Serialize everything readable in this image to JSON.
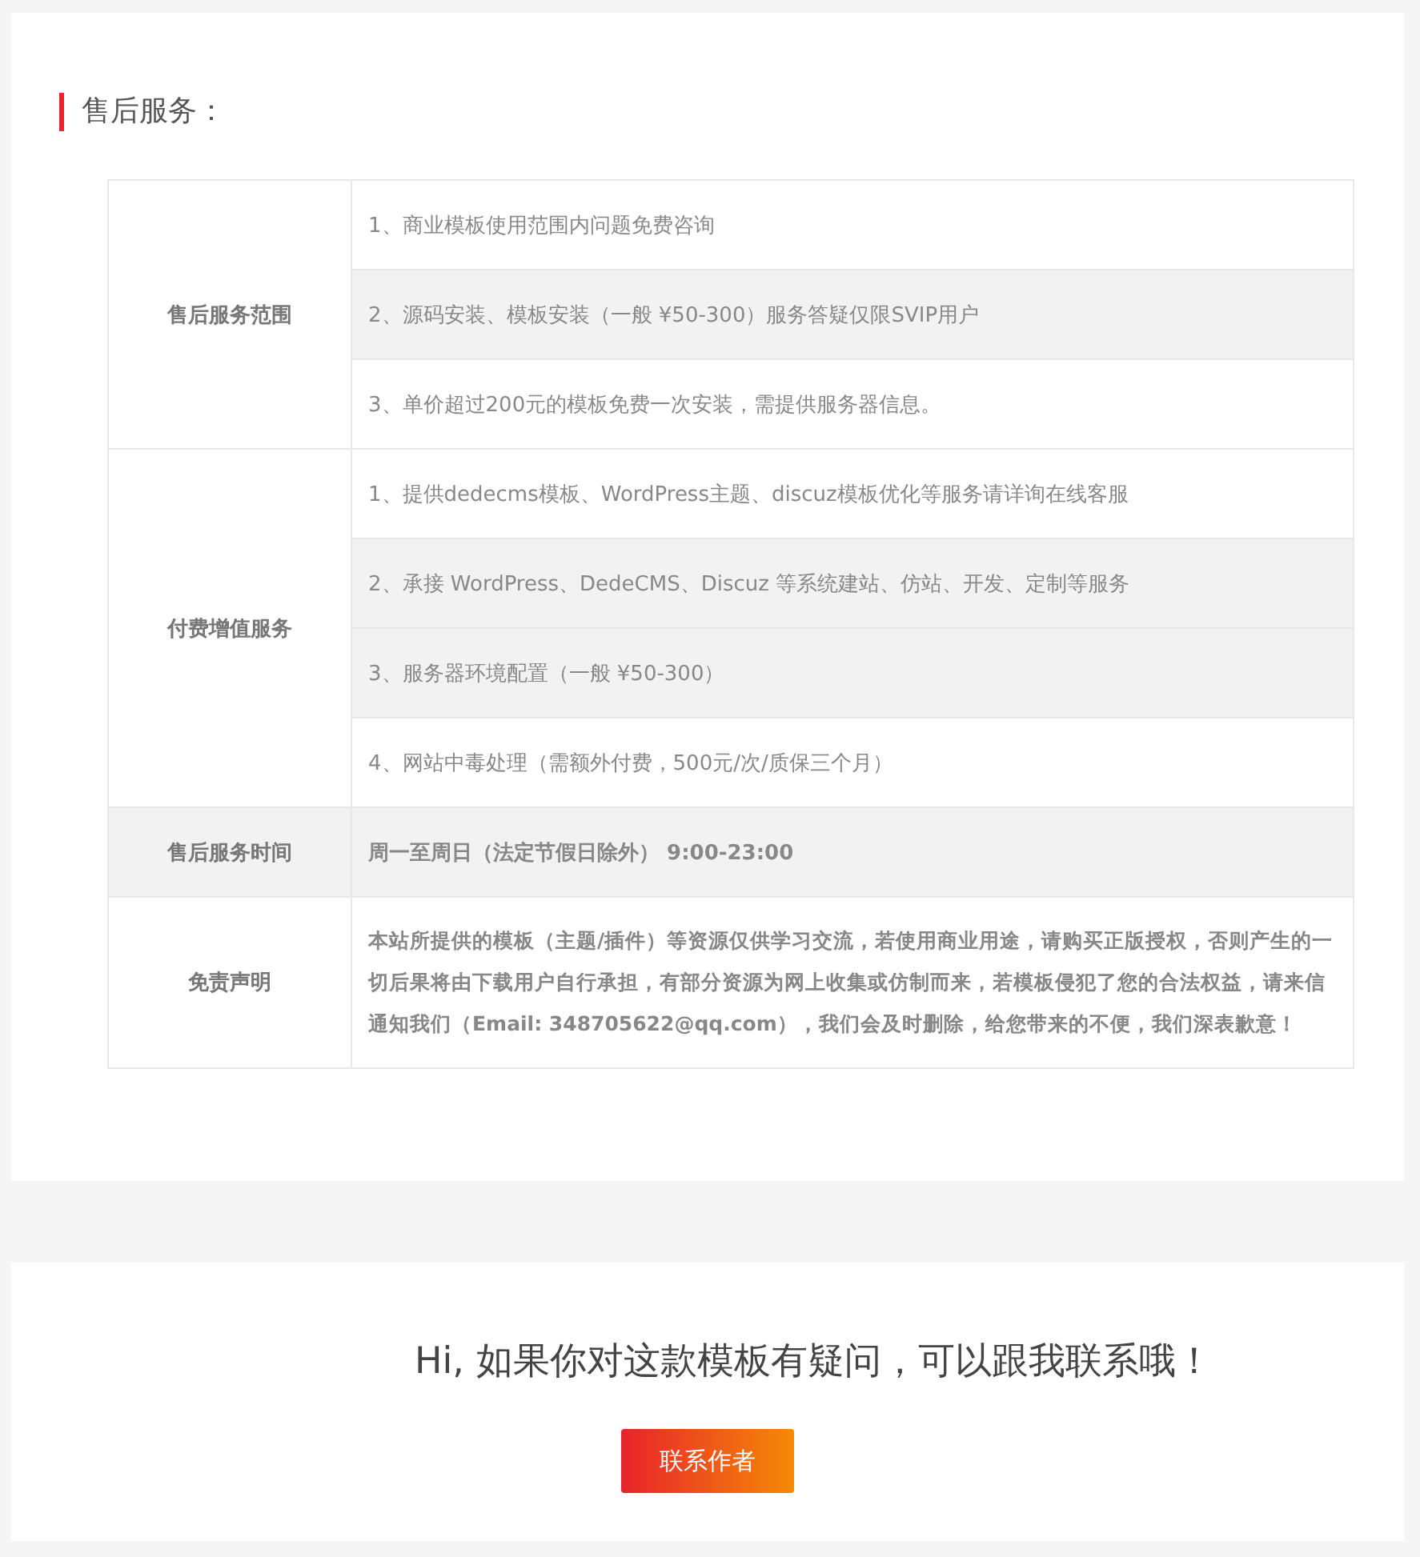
{
  "section_title": "售后服务：",
  "groups": [
    {
      "label": "售后服务范围",
      "shaded": false,
      "bold": false,
      "items": [
        {
          "text": "1、商业模板使用范围内问题免费咨询",
          "shaded": false
        },
        {
          "text": "2、源码安装、模板安装（一般 ¥50-300）服务答疑仅限SVIP用户",
          "shaded": true
        },
        {
          "text": "3、单价超过200元的模板免费一次安装，需提供服务器信息。",
          "shaded": false
        }
      ]
    },
    {
      "label": "付费增值服务",
      "shaded": false,
      "bold": false,
      "items": [
        {
          "text": "1、提供dedecms模板、WordPress主题、discuz模板优化等服务请详询在线客服",
          "shaded": false
        },
        {
          "text": "2、承接 WordPress、DedeCMS、Discuz 等系统建站、仿站、开发、定制等服务",
          "shaded": true
        },
        {
          "text": "3、服务器环境配置（一般 ¥50-300）",
          "shaded": true
        },
        {
          "text": "4、网站中毒处理（需额外付费，500元/次/质保三个月）",
          "shaded": false
        }
      ]
    },
    {
      "label": "售后服务时间",
      "shaded": true,
      "bold": true,
      "items": [
        {
          "text": "周一至周日（法定节假日除外） 9:00-23:00",
          "shaded": true
        }
      ]
    },
    {
      "label": "免责声明",
      "shaded": false,
      "bold": true,
      "items": [
        {
          "text": "本站所提供的模板（主题/插件）等资源仅供学习交流，若使用商业用途，请购买正版授权，否则产生的一切后果将由下载用户自行承担，有部分资源为网上收集或仿制而来，若模板侵犯了您的合法权益，请来信通知我们（Email: 348705622@qq.com），我们会及时删除，给您带来的不便，我们深表歉意！",
          "shaded": false
        }
      ]
    }
  ],
  "contact": {
    "message": "Hi, 如果你对这款模板有疑问，可以跟我联系哦！",
    "button": "联系作者"
  }
}
